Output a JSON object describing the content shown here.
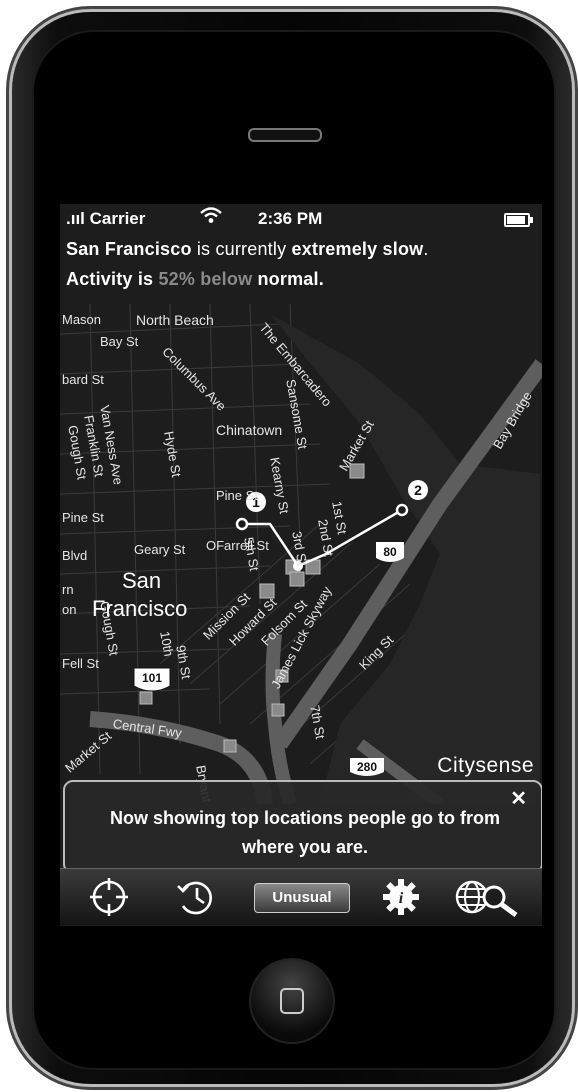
{
  "status_bar": {
    "carrier": ".ııl Carrier",
    "wifi_icon": "wifi-icon",
    "time": "2:36 PM",
    "battery_icon": "battery-icon"
  },
  "header": {
    "city": "San Francisco",
    "line1_mid": " is currently ",
    "speed": "extremely slow",
    "line1_end": ".",
    "line2_start": "Activity is ",
    "percent": "52% below",
    "line2_end": " normal."
  },
  "map": {
    "labels": {
      "mason": "Mason",
      "north_beach": "North Beach",
      "bay_st": "Bay St",
      "columbus_ave": "Columbus Ave",
      "the_embarcadero": "The Embarcadero",
      "bard_st": "bard St",
      "van_ness_ave": "Van Ness Ave",
      "franklin_st": "Franklin St",
      "gough_st": "Gough St",
      "sansome_st": "Sansome St",
      "chinatown": "Chinatown",
      "hyde_st": "Hyde St",
      "kearny_st": "Kearny St",
      "market_st": "Market St",
      "bay_bridge": "Bay Bridge",
      "pine_st": "Pine St",
      "pine_st_2": "Pine St",
      "blvd": "Blvd",
      "geary_st": "Geary St",
      "ofarrell_st": "OFarrell St",
      "first_st": "1st St",
      "second_st": "2nd St",
      "third_st": "3rd St",
      "fifth_st": "5th St",
      "mission_st": "Mission St",
      "howard_st": "Howard St",
      "folsom_st": "Folsom St",
      "gough_st_2": "Gough St",
      "fell_st": "Fell St",
      "tenth_st": "10th",
      "ninth_st": "9th St",
      "james_lick_skyway": "James Lick Skyway",
      "king_st": "King St",
      "seventh_st": "7th St",
      "central_fwy": "Central Fwy",
      "market_st_2": "Market St",
      "bryant": "Bryant",
      "sf_line1": "San",
      "sf_line2": "Francisco",
      "rn": "rn",
      "on": "on"
    },
    "route_start_marker": "1",
    "route_end_marker": "2",
    "shield_80": "80",
    "shield_101": "101",
    "shield_280": "280",
    "brand": "Citysense"
  },
  "notice": {
    "message": "Now showing top locations people go to from where you are.",
    "close": "✕"
  },
  "toolbar": {
    "locate_icon": "crosshair-icon",
    "history_icon": "history-clock-icon",
    "unusual_label": "Unusual",
    "settings_icon": "gear-info-icon",
    "search_icon": "globe-search-icon"
  },
  "colors": {
    "background": "#000000",
    "map_background": "#1d1d1d",
    "highway": "#5e5e5e",
    "text": "#ffffff",
    "highlight_percent": "#8a8a8a"
  }
}
